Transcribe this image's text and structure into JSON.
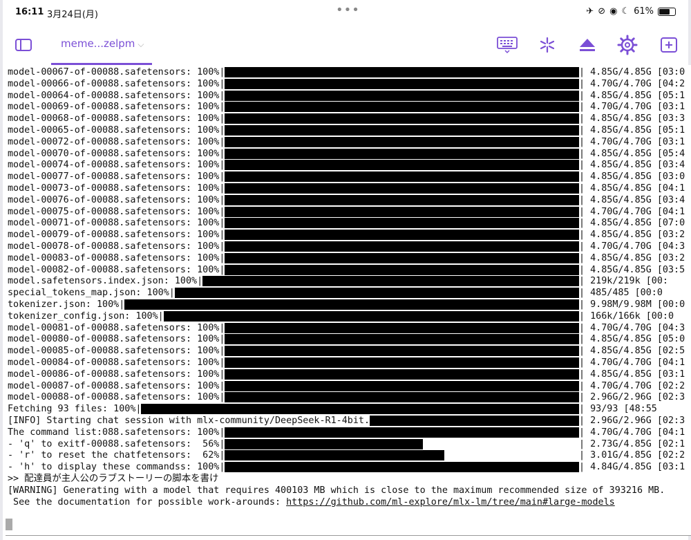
{
  "statusbar": {
    "time": "16:11",
    "date": "3月24日(月)",
    "battery": "61%"
  },
  "tab": {
    "title": "meme...zelpm"
  },
  "progress_rows": [
    {
      "prefix": "model-00067-of-00088.safetensors: 100%|",
      "suffix": "| 4.85G/4.85G [03:0",
      "progress": 1
    },
    {
      "prefix": "model-00066-of-00088.safetensors: 100%|",
      "suffix": "| 4.70G/4.70G [04:2",
      "progress": 1
    },
    {
      "prefix": "model-00064-of-00088.safetensors: 100%|",
      "suffix": "| 4.85G/4.85G [05:1",
      "progress": 1
    },
    {
      "prefix": "model-00069-of-00088.safetensors: 100%|",
      "suffix": "| 4.70G/4.70G [03:1",
      "progress": 1
    },
    {
      "prefix": "model-00068-of-00088.safetensors: 100%|",
      "suffix": "| 4.85G/4.85G [03:3",
      "progress": 1
    },
    {
      "prefix": "model-00065-of-00088.safetensors: 100%|",
      "suffix": "| 4.85G/4.85G [05:1",
      "progress": 1
    },
    {
      "prefix": "model-00072-of-00088.safetensors: 100%|",
      "suffix": "| 4.70G/4.70G [03:1",
      "progress": 1
    },
    {
      "prefix": "model-00070-of-00088.safetensors: 100%|",
      "suffix": "| 4.85G/4.85G [05:4",
      "progress": 1
    },
    {
      "prefix": "model-00074-of-00088.safetensors: 100%|",
      "suffix": "| 4.85G/4.85G [03:4",
      "progress": 1
    },
    {
      "prefix": "model-00077-of-00088.safetensors: 100%|",
      "suffix": "| 4.85G/4.85G [03:0",
      "progress": 1
    },
    {
      "prefix": "model-00073-of-00088.safetensors: 100%|",
      "suffix": "| 4.85G/4.85G [04:1",
      "progress": 1
    },
    {
      "prefix": "model-00076-of-00088.safetensors: 100%|",
      "suffix": "| 4.85G/4.85G [03:4",
      "progress": 1
    },
    {
      "prefix": "model-00075-of-00088.safetensors: 100%|",
      "suffix": "| 4.70G/4.70G [04:1",
      "progress": 1
    },
    {
      "prefix": "model-00071-of-00088.safetensors: 100%|",
      "suffix": "| 4.85G/4.85G [07:0",
      "progress": 1
    },
    {
      "prefix": "model-00079-of-00088.safetensors: 100%|",
      "suffix": "| 4.85G/4.85G [03:2",
      "progress": 1
    },
    {
      "prefix": "model-00078-of-00088.safetensors: 100%|",
      "suffix": "| 4.70G/4.70G [04:3",
      "progress": 1
    },
    {
      "prefix": "model-00083-of-00088.safetensors: 100%|",
      "suffix": "| 4.85G/4.85G [03:2",
      "progress": 1
    },
    {
      "prefix": "model-00082-of-00088.safetensors: 100%|",
      "suffix": "| 4.85G/4.85G [03:5",
      "progress": 1
    },
    {
      "prefix": "model.safetensors.index.json: 100%|",
      "suffix": "| 219k/219k [00:",
      "progress": 1
    },
    {
      "prefix": "special_tokens_map.json: 100%|",
      "suffix": "| 485/485 [00:0",
      "progress": 1
    },
    {
      "prefix": "tokenizer.json: 100%|",
      "suffix": "| 9.98M/9.98M [00:0",
      "progress": 1
    },
    {
      "prefix": "tokenizer_config.json: 100%|",
      "suffix": "| 166k/166k [00:0",
      "progress": 1
    },
    {
      "prefix": "model-00081-of-00088.safetensors: 100%|",
      "suffix": "| 4.70G/4.70G [04:3",
      "progress": 1
    },
    {
      "prefix": "model-00080-of-00088.safetensors: 100%|",
      "suffix": "| 4.85G/4.85G [05:0",
      "progress": 1
    },
    {
      "prefix": "model-00085-of-00088.safetensors: 100%|",
      "suffix": "| 4.85G/4.85G [02:5",
      "progress": 1
    },
    {
      "prefix": "model-00084-of-00088.safetensors: 100%|",
      "suffix": "| 4.70G/4.70G [04:1",
      "progress": 1
    },
    {
      "prefix": "model-00086-of-00088.safetensors: 100%|",
      "suffix": "| 4.85G/4.85G [03:1",
      "progress": 1
    },
    {
      "prefix": "model-00087-of-00088.safetensors: 100%|",
      "suffix": "| 4.70G/4.70G [02:2",
      "progress": 1
    },
    {
      "prefix": "model-00088-of-00088.safetensors: 100%|",
      "suffix": "| 2.96G/2.96G [02:3",
      "progress": 1
    },
    {
      "prefix": "Fetching 93 files: 100%|",
      "suffix": "| 93/93 [48:55",
      "progress": 1
    },
    {
      "prefix": "[INFO] Starting chat session with mlx-community/DeepSeek-R1-4bit.",
      "suffix": "| 2.96G/2.96G [02:3",
      "progress": 1
    },
    {
      "prefix": "The command list:088.safetensors: 100%|",
      "suffix": "| 4.70G/4.70G [04:1",
      "progress": 1
    },
    {
      "prefix": "- 'q' to exitf-00088.safetensors:  56%|",
      "suffix": "| 2.73G/4.85G [02:1",
      "progress": 0.56
    },
    {
      "prefix": "- 'r' to reset the chatfetensors:  62%|",
      "suffix": "| 3.01G/4.85G [02:2",
      "progress": 0.62
    },
    {
      "prefix": "- 'h' to display these commandss: 100%|",
      "suffix": "| 4.84G/4.85G [03:1",
      "progress": 1
    }
  ],
  "text_lines": [
    ">> 配達員が主人公のラブストーリーの脚本を書け",
    "[WARNING] Generating with a model that requires 400103 MB which is close to the maximum recommended size of 393216 MB.",
    " See the documentation for possible work-arounds: "
  ],
  "link": "https://github.com/ml-explore/mlx-lm/tree/main#large-models"
}
